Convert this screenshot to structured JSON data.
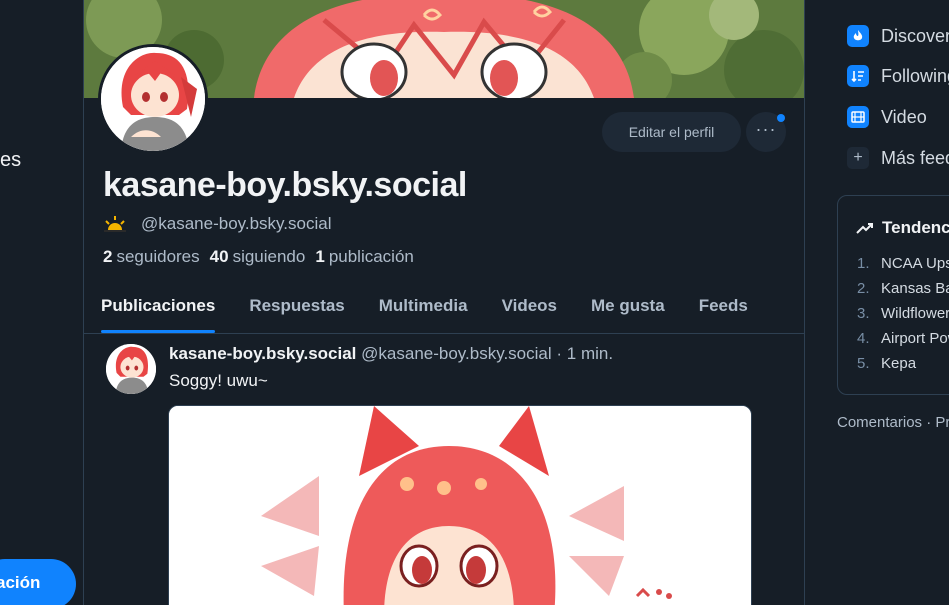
{
  "sidebar": {
    "partial_label": "es",
    "new_post_label": "ación"
  },
  "profile": {
    "display_name": "kasane-boy.bsky.social",
    "handle": "@kasane-boy.bsky.social",
    "handle_emoji": "sunrise-icon",
    "edit_label": "Editar el perfil",
    "more_label": "···",
    "stats": {
      "followers_count": "2",
      "followers_label": "seguidores",
      "following_count": "40",
      "following_label": "siguiendo",
      "posts_count": "1",
      "posts_label": "publicación"
    }
  },
  "tabs": [
    {
      "label": "Publicaciones",
      "active": true
    },
    {
      "label": "Respuestas",
      "active": false
    },
    {
      "label": "Multimedia",
      "active": false
    },
    {
      "label": "Videos",
      "active": false
    },
    {
      "label": "Me gusta",
      "active": false
    },
    {
      "label": "Feeds",
      "active": false
    }
  ],
  "post": {
    "author_name": "kasane-boy.bsky.social",
    "author_handle": "@kasane-boy.bsky.social",
    "separator": "·",
    "time": "1 min.",
    "text": "Soggy! uwu~"
  },
  "right_sidebar": {
    "feeds": [
      {
        "label": "Discover",
        "icon": "discover-icon"
      },
      {
        "label": "Following",
        "icon": "following-icon"
      },
      {
        "label": "Video",
        "icon": "video-icon"
      },
      {
        "label": "Más feeds",
        "icon": "plus-icon"
      }
    ],
    "trending": {
      "title": "Tendencias",
      "items": [
        {
          "rank": "1.",
          "label": "NCAA Upsets"
        },
        {
          "rank": "2.",
          "label": "Kansas Basketball"
        },
        {
          "rank": "3.",
          "label": "Wildflowers"
        },
        {
          "rank": "4.",
          "label": "Airport Power"
        },
        {
          "rank": "5.",
          "label": "Kepa"
        }
      ]
    },
    "footer": "Comentarios · Privacidad"
  },
  "colors": {
    "background": "#161e27",
    "accent": "#1083fe",
    "border": "#2e4052",
    "muted_text": "#aebbc9"
  }
}
